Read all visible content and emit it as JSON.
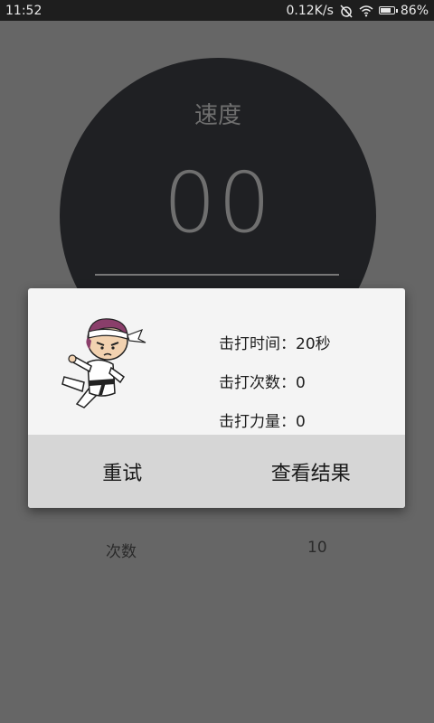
{
  "status_bar": {
    "time": "11:52",
    "network_speed": "0.12K/s",
    "battery_percent": "86%",
    "battery_level": 0.86,
    "icons": [
      "alarm-off-icon",
      "wifi-icon",
      "battery-icon"
    ]
  },
  "gauge": {
    "label": "速度",
    "value": "00"
  },
  "count_row": {
    "label": "次数",
    "value": "10"
  },
  "dialog": {
    "mascot": "karate-kid-icon",
    "stats": [
      {
        "label": "击打时间：",
        "value": "20秒"
      },
      {
        "label": "击打次数：",
        "value": "0"
      },
      {
        "label": "击打力量：",
        "value": "0"
      }
    ],
    "buttons": {
      "retry": "重试",
      "view_results": "查看结果"
    }
  },
  "colors": {
    "background": "#666666",
    "gauge": "#1f2023",
    "dialog": "#f4f4f4",
    "dialog_buttons": "#d6d6d6",
    "statusbar": "#1e1e1e"
  }
}
